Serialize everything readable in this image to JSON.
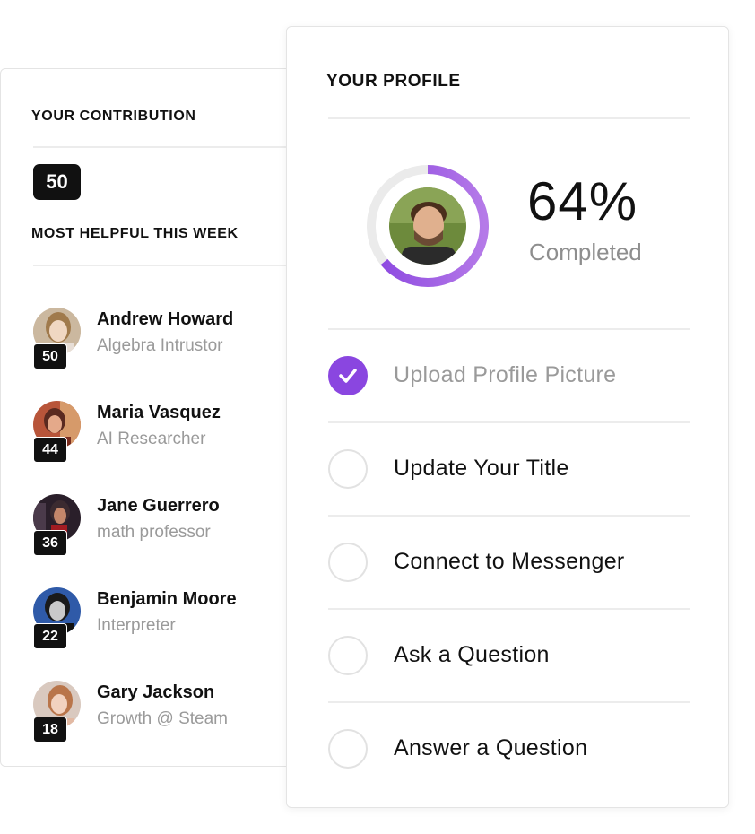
{
  "contribution": {
    "title": "YOUR CONTRIBUTION",
    "score": "50",
    "most_helpful_title": "MOST HELPFUL THIS WEEK",
    "users": [
      {
        "name": "Andrew Howard",
        "title": "Algebra Intrustor",
        "points": "50"
      },
      {
        "name": "Maria Vasquez",
        "title": "AI Researcher",
        "points": "44"
      },
      {
        "name": "Jane Guerrero",
        "title": "math professor",
        "points": "36"
      },
      {
        "name": "Benjamin Moore",
        "title": "Interpreter",
        "points": "22"
      },
      {
        "name": "Gary Jackson",
        "title": "Growth @ Steam",
        "points": "18"
      }
    ]
  },
  "profile": {
    "title": "YOUR PROFILE",
    "progress_percent": 64,
    "progress_label": "64%",
    "completed_label": "Completed",
    "tasks": [
      {
        "label": "Upload Profile Picture",
        "done": true
      },
      {
        "label": "Update Your Title",
        "done": false
      },
      {
        "label": "Connect to Messenger",
        "done": false
      },
      {
        "label": "Ask a Question",
        "done": false
      },
      {
        "label": "Answer a Question",
        "done": false
      }
    ]
  },
  "colors": {
    "accent": "#8a46e0",
    "accent_light": "#b57ae8",
    "badge": "#111111"
  },
  "icons": {
    "check": "check-icon",
    "avatar": "avatar"
  }
}
